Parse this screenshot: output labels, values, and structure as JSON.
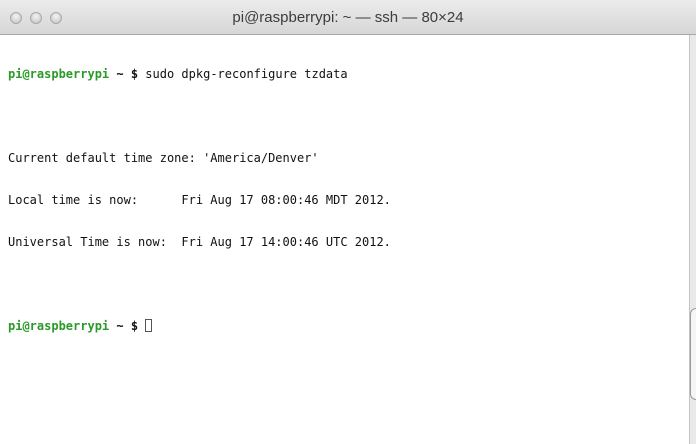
{
  "window": {
    "title": "pi@raspberrypi: ~ — ssh — 80×24"
  },
  "terminal": {
    "prompt_user": "pi@raspberrypi",
    "prompt_path": " ~ ",
    "prompt_symbol": "$",
    "command": " sudo dpkg-reconfigure tzdata",
    "output": [
      "Current default time zone: 'America/Denver'",
      "Local time is now:      Fri Aug 17 08:00:46 MDT 2012.",
      "Universal Time is now:  Fri Aug 17 14:00:46 UTC 2012."
    ],
    "second_prompt_user": "pi@raspberrypi",
    "second_prompt_path": " ~ ",
    "second_prompt_symbol": "$ "
  },
  "colors": {
    "prompt_user": "#2a9a28",
    "text": "#111111",
    "background": "#ffffff"
  }
}
